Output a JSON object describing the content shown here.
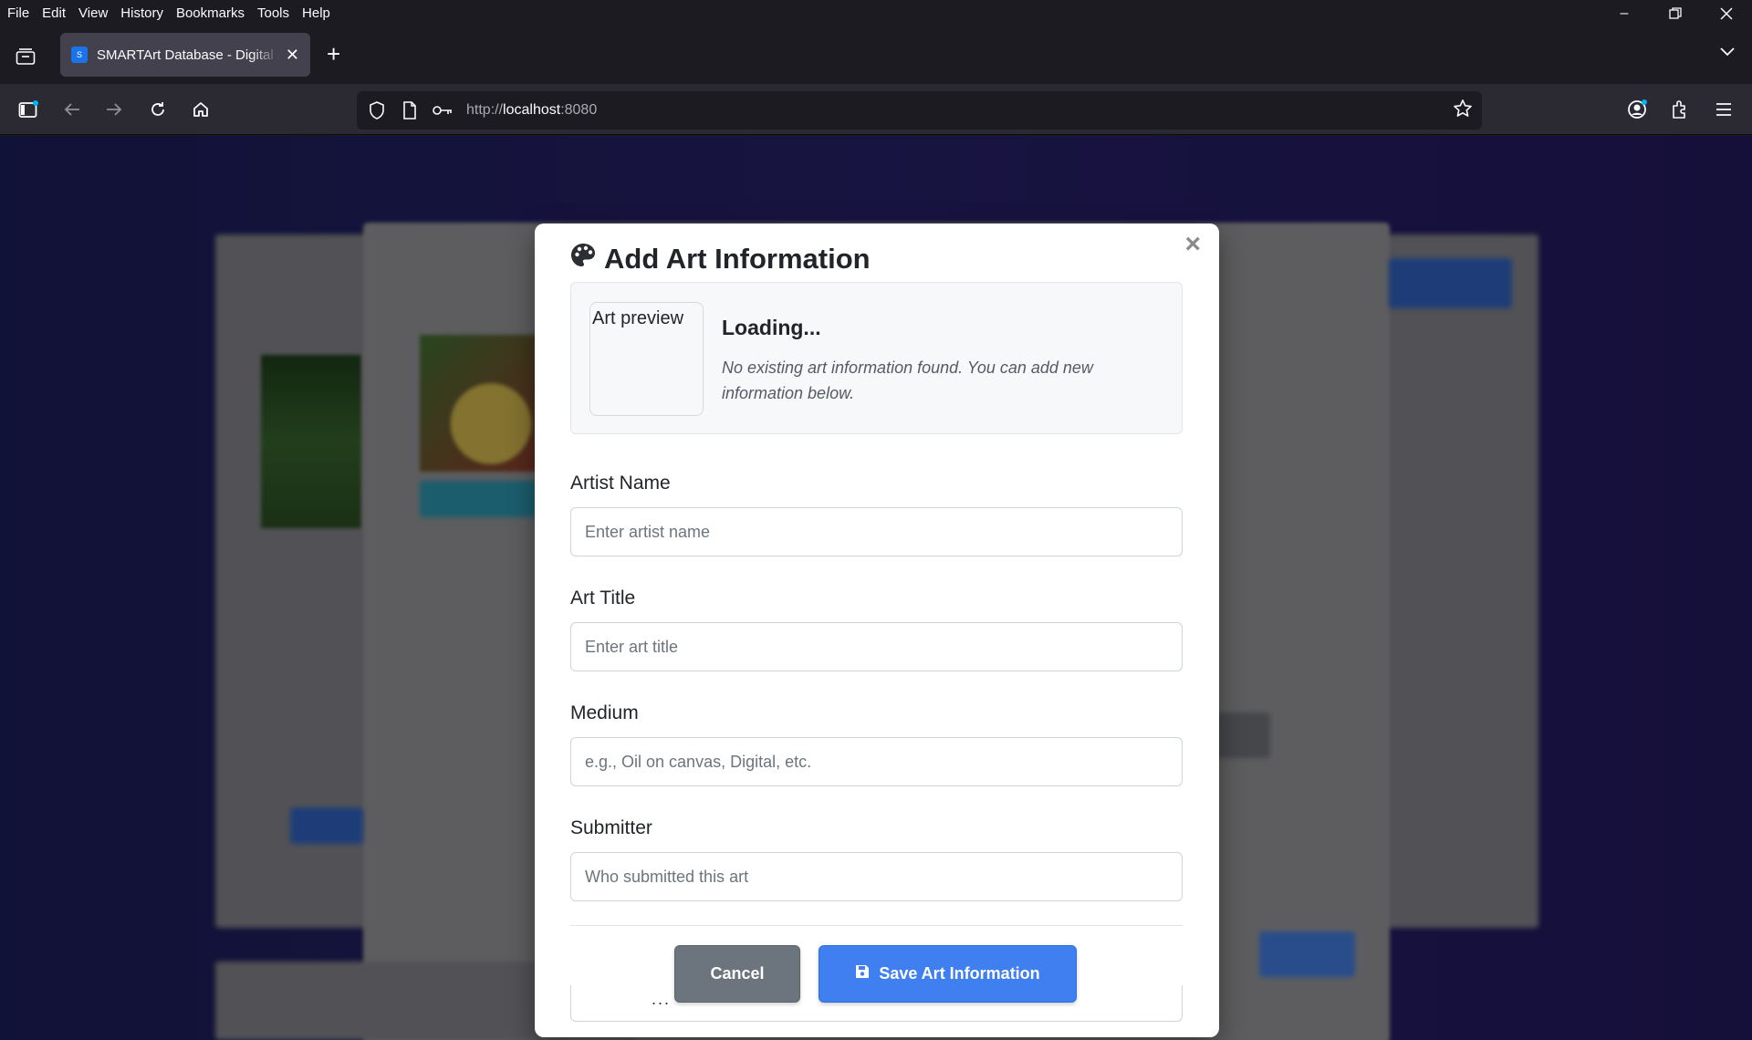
{
  "menu": [
    "File",
    "Edit",
    "View",
    "History",
    "Bookmarks",
    "Tools",
    "Help"
  ],
  "tab": {
    "title": "SMARTArt Database - Digital Art",
    "favicon_letter": "S"
  },
  "url": {
    "scheme": "http://",
    "host": "localhost",
    "port": ":8080"
  },
  "modal": {
    "title": "Add Art Information",
    "preview": {
      "image_alt": "Art preview",
      "status": "Loading...",
      "message": "No existing art information found. You can add new information below."
    },
    "fields": {
      "artist": {
        "label": "Artist Name",
        "placeholder": "Enter artist name"
      },
      "title": {
        "label": "Art Title",
        "placeholder": "Enter art title"
      },
      "medium": {
        "label": "Medium",
        "placeholder": "e.g., Oil on canvas, Digital, etc."
      },
      "submitter": {
        "label": "Submitter",
        "placeholder": "Who submitted this art"
      }
    },
    "buttons": {
      "cancel": "Cancel",
      "save": "Save Art Information"
    },
    "overflow_text": "..."
  },
  "colors": {
    "primary": "#3f7ff0",
    "secondary": "#6c757d",
    "page_bg": "#221d5e"
  }
}
